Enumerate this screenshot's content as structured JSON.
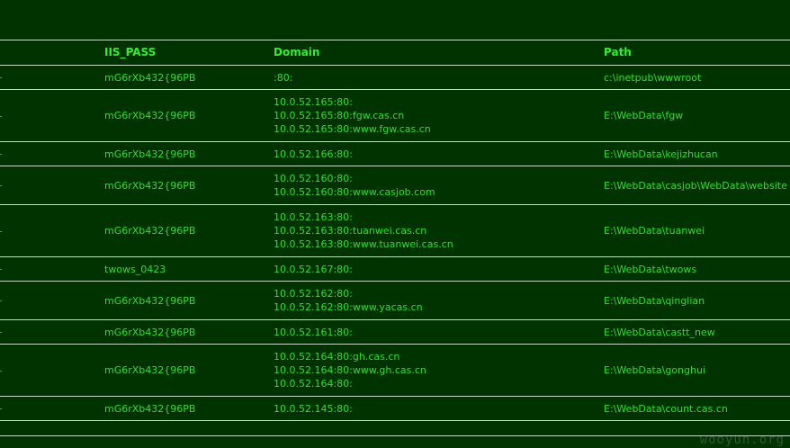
{
  "table": {
    "headers": {
      "pass": "IIS_PASS",
      "domain": "Domain",
      "path": "Path"
    },
    "rows": [
      {
        "pass": "mG6rXb432{96PB",
        "domains": [
          ":80:"
        ],
        "path": "c:\\inetpub\\wwwroot"
      },
      {
        "pass": "mG6rXb432{96PB",
        "domains": [
          "10.0.52.165:80:",
          "10.0.52.165:80:fgw.cas.cn",
          "10.0.52.165:80:www.fgw.cas.cn"
        ],
        "path": "E:\\WebData\\fgw"
      },
      {
        "pass": "mG6rXb432{96PB",
        "domains": [
          "10.0.52.166:80:"
        ],
        "path": "E:\\WebData\\kejizhucan"
      },
      {
        "pass": "mG6rXb432{96PB",
        "domains": [
          "10.0.52.160:80:",
          "10.0.52.160:80:www.casjob.com"
        ],
        "path": "E:\\WebData\\casjob\\WebData\\website"
      },
      {
        "pass": "mG6rXb432{96PB",
        "domains": [
          "10.0.52.163:80:",
          "10.0.52.163:80:tuanwei.cas.cn",
          "10.0.52.163:80:www.tuanwei.cas.cn"
        ],
        "path": "E:\\WebData\\tuanwei"
      },
      {
        "pass": "twows_0423",
        "domains": [
          "10.0.52.167:80:"
        ],
        "path": "E:\\WebData\\twows"
      },
      {
        "pass": "mG6rXb432{96PB",
        "domains": [
          "10.0.52.162:80:",
          "10.0.52.162:80:www.yacas.cn"
        ],
        "path": "E:\\WebData\\qinglian"
      },
      {
        "pass": "mG6rXb432{96PB",
        "domains": [
          "10.0.52.161:80:"
        ],
        "path": "E:\\WebData\\castt_new"
      },
      {
        "pass": "mG6rXb432{96PB",
        "domains": [
          "10.0.52.164:80:gh.cas.cn",
          "10.0.52.164:80:www.gh.cas.cn",
          "10.0.52.164:80:"
        ],
        "path": "E:\\WebData\\gonghui"
      },
      {
        "pass": "mG6rXb432{96PB",
        "domains": [
          "10.0.52.145:80:"
        ],
        "path": "E:\\WebData\\count.cas.cn"
      }
    ]
  },
  "watermark": "wooyun.org",
  "colors": {
    "background": "#003300",
    "text": "#33dd33",
    "rule": "#c8d8c8"
  }
}
